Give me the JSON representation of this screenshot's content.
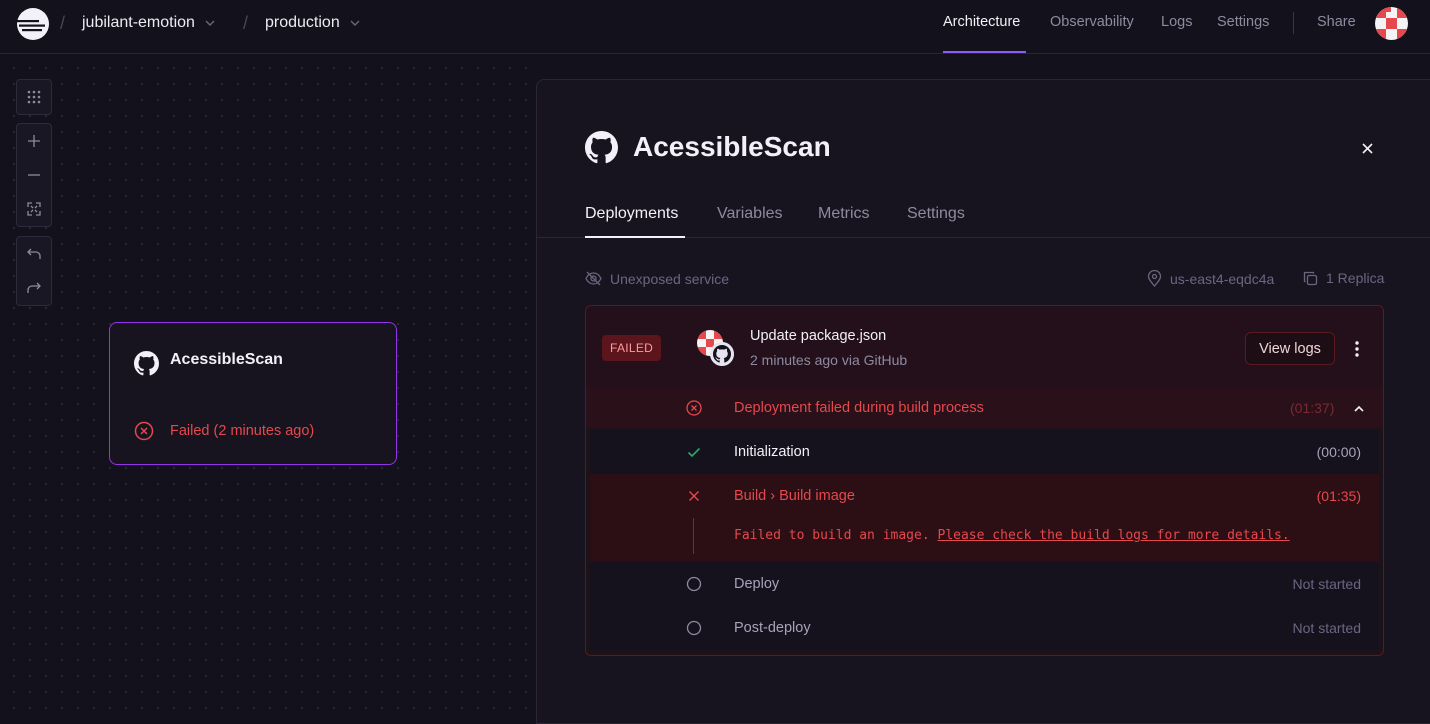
{
  "header": {
    "project": "jubilant-emotion",
    "environment": "production",
    "nav": [
      "Architecture",
      "Observability",
      "Logs",
      "Settings"
    ],
    "active_nav": "Architecture",
    "share": "Share"
  },
  "canvas": {
    "service_card": {
      "name": "AcessibleScan",
      "status": "Failed (2 minutes ago)"
    }
  },
  "panel": {
    "title": "AcessibleScan",
    "tabs": [
      "Deployments",
      "Variables",
      "Metrics",
      "Settings"
    ],
    "active_tab": "Deployments",
    "exposure": "Unexposed service",
    "region": "us-east4-eqdc4a",
    "replicas": "1 Replica",
    "deployment": {
      "badge": "FAILED",
      "commit_title": "Update package.json",
      "commit_subtitle": "2 minutes ago via GitHub",
      "view_logs": "View logs",
      "failure_summary": "Deployment failed during build process",
      "failure_time": "(01:37)",
      "steps": [
        {
          "label": "Initialization",
          "time": "(00:00)",
          "status": "success"
        },
        {
          "label": "Build › Build image",
          "time": "(01:35)",
          "status": "failed",
          "message": "Failed to build an image.",
          "message_link": "Please check the build logs for more details."
        },
        {
          "label": "Deploy",
          "time": "Not started",
          "status": "pending"
        },
        {
          "label": "Post-deploy",
          "time": "Not started",
          "status": "pending"
        }
      ]
    }
  },
  "colors": {
    "accent": "#8b5cf6",
    "error": "#e5484d",
    "success": "#30a46c",
    "background": "#13111c"
  }
}
